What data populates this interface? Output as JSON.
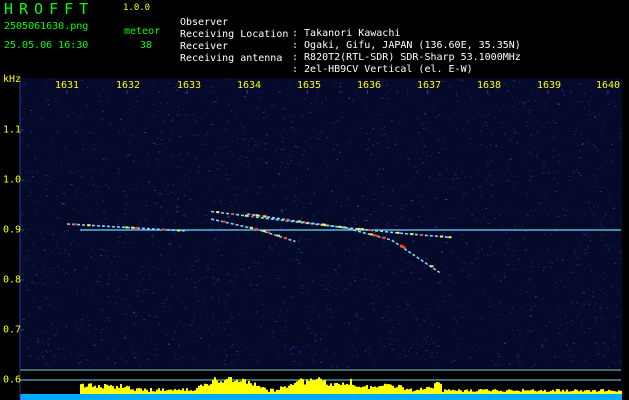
{
  "header": {
    "app_name": "HROFFT",
    "version": "1.0.0",
    "filename": "2505061630.png",
    "meteor_label": "meteor",
    "datetime": "25.05.06 16:30",
    "meteor_count": "38"
  },
  "info": [
    {
      "key": "Observer",
      "value": ": Takanori Kawachi"
    },
    {
      "key": "Receiving Location",
      "value": ": Ogaki, Gifu, JAPAN (136.60E, 35.35N)"
    },
    {
      "key": "Receiver",
      "value": ": R820T2(RTL-SDR) SDR-Sharp 53.1000MHz"
    },
    {
      "key": "Receiving antenna",
      "value": ": 2el-HB9CV Vertical (el. E-W)"
    }
  ],
  "chart_data": {
    "type": "heatmap",
    "ylabel": "kHz",
    "x_ticks": [
      "1631",
      "1632",
      "1633",
      "1634",
      "1635",
      "1636",
      "1637",
      "1638",
      "1639",
      "1640"
    ],
    "y_ticks": [
      "1.1",
      "1.0",
      "0.9",
      "0.8",
      "0.7",
      "0.6"
    ],
    "xlim": [
      1630.2,
      1640.5
    ],
    "ylim": [
      0.58,
      1.16
    ],
    "baseline_freq_khz": 0.9,
    "meteor_traces": [
      {
        "x": [
          1633.4,
          1634.4,
          1635.6,
          1636.6,
          1637.4
        ],
        "y": [
          0.937,
          0.922,
          0.905,
          0.893,
          0.885
        ]
      },
      {
        "x": [
          1634.0,
          1634.8,
          1635.6
        ],
        "y": [
          0.932,
          0.918,
          0.905
        ]
      },
      {
        "x": [
          1633.4,
          1634.2,
          1634.8
        ],
        "y": [
          0.922,
          0.9,
          0.877
        ]
      },
      {
        "x": [
          1635.6,
          1636.4,
          1637.2
        ],
        "y": [
          0.905,
          0.88,
          0.815
        ]
      },
      {
        "x": [
          1631.0,
          1632.0,
          1633.0
        ],
        "y": [
          0.912,
          0.905,
          0.898
        ]
      }
    ],
    "colors": {
      "background": "#000000",
      "noise": "#1a2e8c",
      "baseline": "#6fd4ff",
      "trace_mid": "#7fd7ff",
      "trace_hot": "#ff4020",
      "trace_warm": "#ffee40",
      "bottom_bars": "#ffff00",
      "bottom_strip": "#00aaff",
      "labels": "#ffff00"
    }
  }
}
